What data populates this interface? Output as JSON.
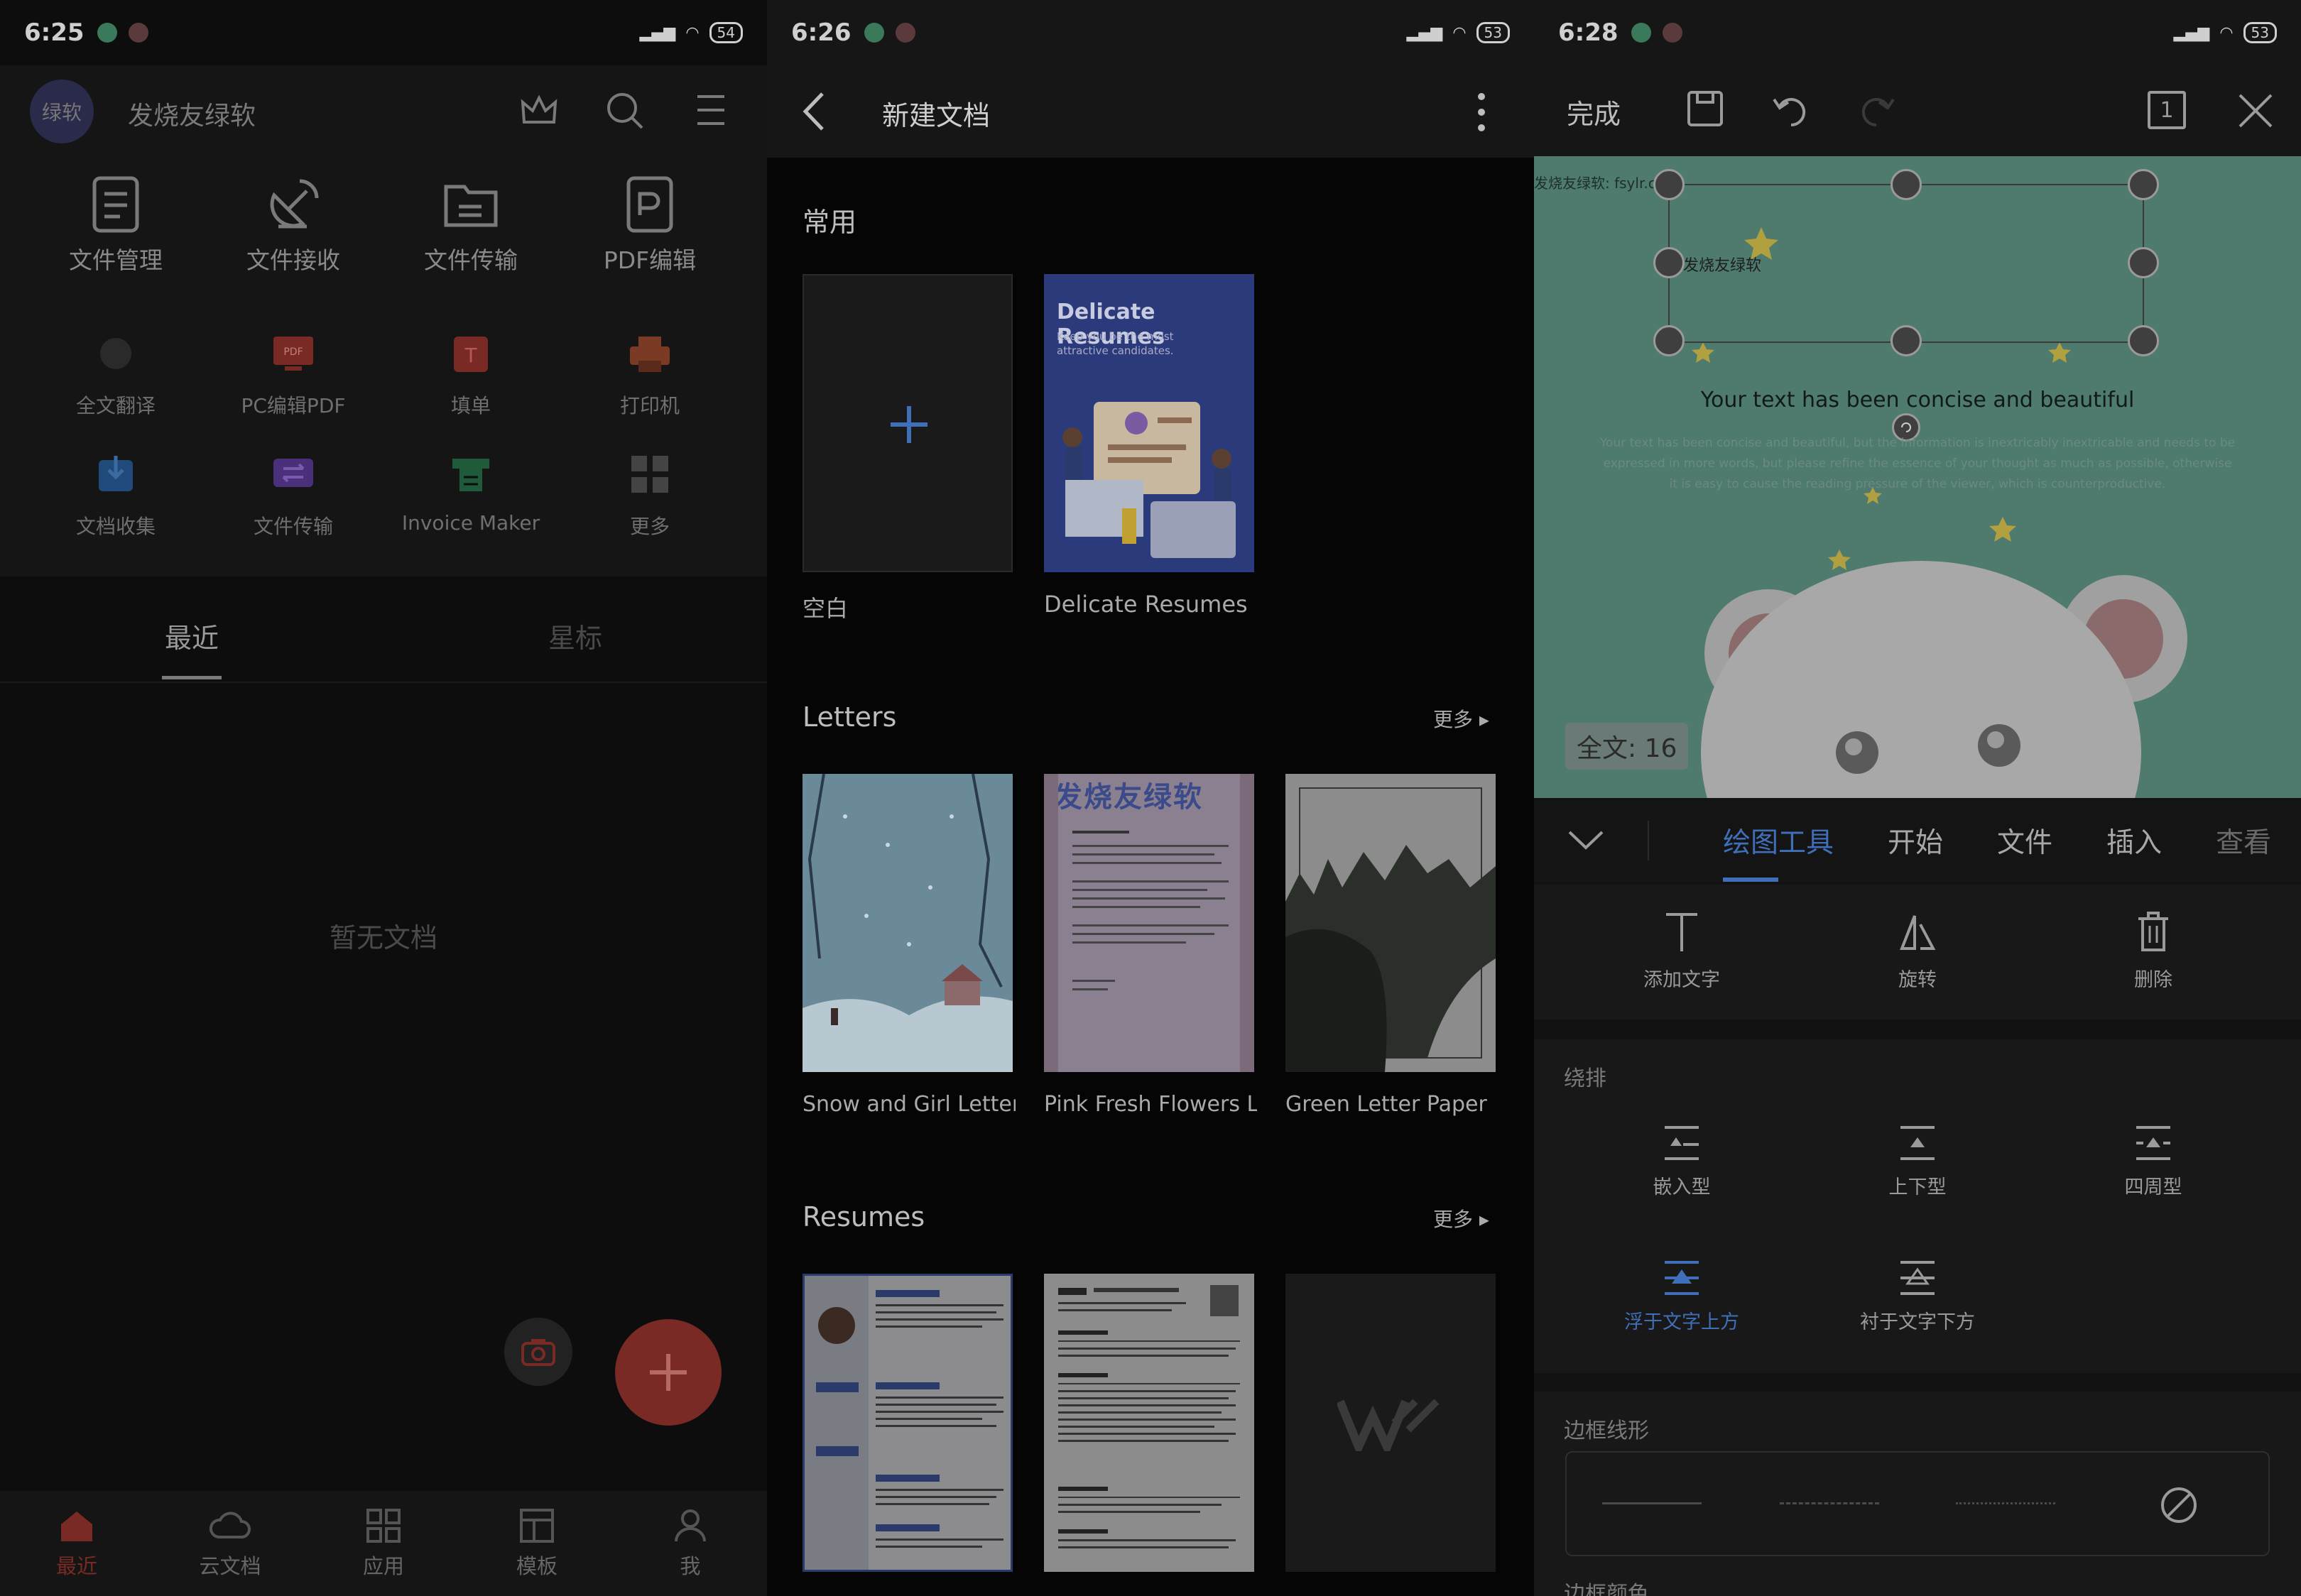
{
  "panel1": {
    "status": {
      "time": "6:25",
      "battery": "54"
    },
    "header": {
      "avatar_text": "绿软",
      "username": "发烧友绿软"
    },
    "grid_main": [
      {
        "label": "文件管理",
        "icon": "file-manage-icon"
      },
      {
        "label": "文件接收",
        "icon": "satellite-receive-icon"
      },
      {
        "label": "文件传输",
        "icon": "folder-transfer-icon"
      },
      {
        "label": "PDF编辑",
        "icon": "pdf-edit-icon"
      }
    ],
    "grid_secondary": [
      {
        "label": "全文翻译",
        "icon": "translate-icon",
        "color": "#333333"
      },
      {
        "label": "PC编辑PDF",
        "icon": "pc-pdf-icon",
        "color": "#7a2a24"
      },
      {
        "label": "填单",
        "icon": "fill-form-icon",
        "color": "#7a2a24"
      },
      {
        "label": "打印机",
        "icon": "printer-icon",
        "color": "#7a3a24"
      },
      {
        "label": "文档收集",
        "icon": "doc-collect-icon",
        "color": "#1f4a7a"
      },
      {
        "label": "文件传输",
        "icon": "file-transfer-icon",
        "color": "#4a2f7a"
      },
      {
        "label": "Invoice Maker",
        "icon": "invoice-maker-icon",
        "color": "#1f5a3a"
      },
      {
        "label": "更多",
        "icon": "more-apps-icon",
        "color": "#444444"
      }
    ],
    "tabs": {
      "recent": "最近",
      "starred": "星标"
    },
    "empty_text": "暂无文档",
    "bottom_nav": [
      {
        "label": "最近",
        "icon": "home-icon"
      },
      {
        "label": "云文档",
        "icon": "cloud-icon"
      },
      {
        "label": "应用",
        "icon": "apps-grid-icon"
      },
      {
        "label": "模板",
        "icon": "template-icon"
      },
      {
        "label": "我",
        "icon": "profile-icon"
      }
    ],
    "accent": "#7a2a24"
  },
  "panel2": {
    "status": {
      "time": "6:26",
      "battery": "53"
    },
    "title": "新建文档",
    "section_common": "常用",
    "common": [
      {
        "label": "空白"
      },
      {
        "label": "Delicate Resumes",
        "thumb_title": "Delicate Resumes",
        "thumb_sub": "Keep you be the most attractive candidates."
      }
    ],
    "section_letters": "Letters",
    "letters_more": "更多",
    "letters": [
      {
        "label": "Snow and Girl Letter"
      },
      {
        "label": "Pink Fresh Flowers Le..."
      },
      {
        "label": "Green Letter Paper"
      }
    ],
    "watermark": "发烧友绿软",
    "section_resumes": "Resumes",
    "resumes_more": "更多"
  },
  "panel3": {
    "status": {
      "time": "6:28",
      "battery": "53"
    },
    "toolbar": {
      "done": "完成",
      "page_indicator": "1"
    },
    "canvas": {
      "corner_text": "发烧友绿软: fsylr.cc",
      "box_text": "发烧友绿软",
      "headline": "Your text has been concise and beautiful",
      "body": "Your text has been concise and beautiful, but the information is inextricably inextricable and needs to be expressed in more words, but please refine the essence of your thought as much as possible, otherwise it is easy to cause the reading pressure of the viewer, which is counterproductive.",
      "count_badge": "全文: 16"
    },
    "tabs": [
      "绘图工具",
      "开始",
      "文件",
      "插入",
      "查看"
    ],
    "tools": [
      {
        "label": "添加文字",
        "icon": "add-text-icon"
      },
      {
        "label": "旋转",
        "icon": "rotate-icon"
      },
      {
        "label": "删除",
        "icon": "trash-icon"
      }
    ],
    "wrap_title": "绕排",
    "wrap_options": [
      {
        "label": "嵌入型",
        "icon": "wrap-inline-icon"
      },
      {
        "label": "上下型",
        "icon": "wrap-topbottom-icon"
      },
      {
        "label": "四周型",
        "icon": "wrap-square-icon"
      },
      {
        "label": "浮于文字上方",
        "icon": "wrap-front-icon"
      },
      {
        "label": "衬于文字下方",
        "icon": "wrap-behind-icon"
      }
    ],
    "border_title": "边框线形",
    "border_color_title": "边框颜色",
    "accent": "#3f6fb8"
  }
}
